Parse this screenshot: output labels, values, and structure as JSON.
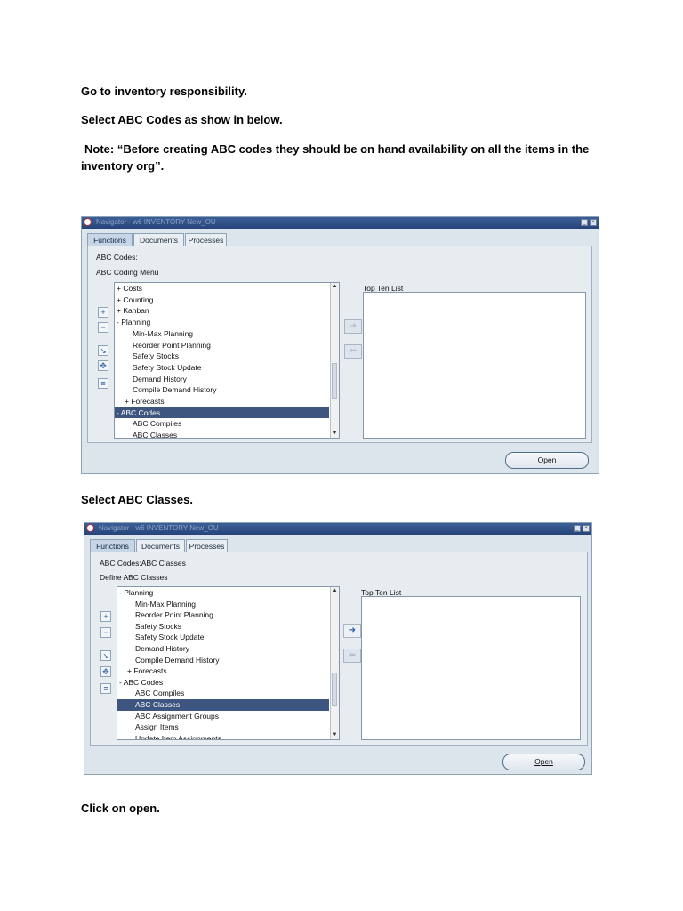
{
  "instructions": {
    "step1": "Go to inventory responsibility.",
    "step2": "Select ABC Codes as show in below.",
    "note": "Note: “Before creating ABC codes they should be on hand availability on all the items in the inventory org”.",
    "step3": "Select ABC Classes.",
    "step4": "Click on open."
  },
  "navigator1": {
    "title": "Navigator - w6 INVENTORY New_OU",
    "tabs": [
      "Functions",
      "Documents",
      "Processes"
    ],
    "path": "ABC Codes:",
    "menu": "ABC Coding Menu",
    "top_ten_label": "Top Ten List",
    "open_button": "Open",
    "tree": [
      {
        "text": "+ Costs",
        "indent": 0,
        "selected": false
      },
      {
        "text": "+ Counting",
        "indent": 0,
        "selected": false
      },
      {
        "text": "+ Kanban",
        "indent": 0,
        "selected": false
      },
      {
        "text": "- Planning",
        "indent": 0,
        "selected": false
      },
      {
        "text": "Min-Max Planning",
        "indent": 2,
        "selected": false
      },
      {
        "text": "Reorder Point Planning",
        "indent": 2,
        "selected": false
      },
      {
        "text": "Safety Stocks",
        "indent": 2,
        "selected": false
      },
      {
        "text": "Safety Stock Update",
        "indent": 2,
        "selected": false
      },
      {
        "text": "Demand History",
        "indent": 2,
        "selected": false
      },
      {
        "text": "Compile Demand History",
        "indent": 2,
        "selected": false
      },
      {
        "text": "+ Forecasts",
        "indent": 1,
        "selected": false
      },
      {
        "text": "- ABC Codes",
        "indent": 0,
        "selected": true
      },
      {
        "text": "ABC Compiles",
        "indent": 2,
        "selected": false
      },
      {
        "text": "ABC Classes",
        "indent": 2,
        "selected": false
      }
    ]
  },
  "navigator2": {
    "title": "Navigator - w6 INVENTORY New_OU",
    "tabs": [
      "Functions",
      "Documents",
      "Processes"
    ],
    "path": "ABC Codes:ABC Classes",
    "menu": "Define ABC Classes",
    "top_ten_label": "Top Ten List",
    "open_button": "Open",
    "tree": [
      {
        "text": "- Planning",
        "indent": 0,
        "selected": false
      },
      {
        "text": "Min-Max Planning",
        "indent": 2,
        "selected": false
      },
      {
        "text": "Reorder Point Planning",
        "indent": 2,
        "selected": false
      },
      {
        "text": "Safety Stocks",
        "indent": 2,
        "selected": false
      },
      {
        "text": "Safety Stock Update",
        "indent": 2,
        "selected": false
      },
      {
        "text": "Demand History",
        "indent": 2,
        "selected": false
      },
      {
        "text": "Compile Demand History",
        "indent": 2,
        "selected": false
      },
      {
        "text": "+ Forecasts",
        "indent": 1,
        "selected": false
      },
      {
        "text": "- ABC Codes",
        "indent": 0,
        "selected": false
      },
      {
        "text": "ABC Compiles",
        "indent": 2,
        "selected": false
      },
      {
        "text": "ABC Classes",
        "indent": 2,
        "selected": true
      },
      {
        "text": "ABC Assignment Groups",
        "indent": 2,
        "selected": false
      },
      {
        "text": "Assign Items",
        "indent": 2,
        "selected": false
      },
      {
        "text": "Update Item Assignments",
        "indent": 2,
        "selected": false
      }
    ]
  },
  "icons": {
    "logo": "oracle-logo-icon",
    "add": "plus-icon",
    "remove": "minus-icon",
    "expand": "expand-icon",
    "collapse": "collapse-icon",
    "right": "arrow-right-icon",
    "left": "arrow-left-icon"
  },
  "colors": {
    "selected_row": "#3e567f",
    "titlebar": "#26447a",
    "window_bg": "#dce4ec"
  }
}
